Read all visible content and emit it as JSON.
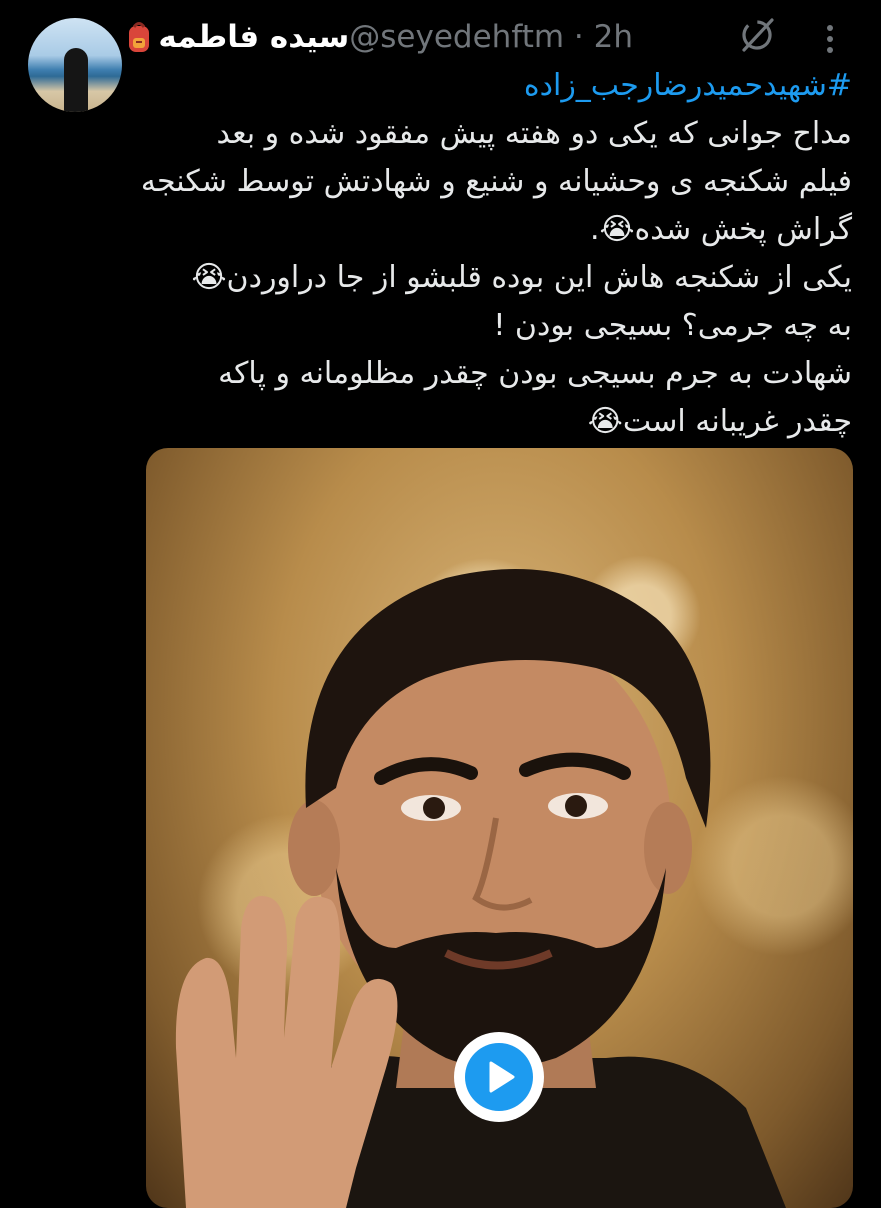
{
  "tweet": {
    "author": {
      "display_name": "سیده فاطمه",
      "name_emoji_icon": "backpack-icon",
      "handle": "@seyedehftm",
      "separator": "·",
      "time": "2h"
    },
    "actions": {
      "grok_icon": "grok-icon",
      "more_icon": "more-icon"
    },
    "hashtag": "#شهیدحمیدرضارجب_زاده",
    "lines": [
      "مداح جوانی که یکی دو هفته پیش مفقود شده و بعد",
      "فیلم شکنجه ی وحشیانه و شنیع و شهادتش توسط شکنجه",
      "گراش پخش شده😭.",
      "یکی از شکنجه هاش این بوده قلبشو از جا دراوردن😭",
      "به چه جرمی؟ بسیجی بودن !",
      "شهادت به جرم بسیجی بودن چقدر مظلومانه و پاکه",
      "چقدر غریبانه است😭"
    ],
    "media": {
      "type": "video",
      "play_icon": "play-icon"
    }
  },
  "colors": {
    "background": "#000000",
    "text": "#e7e9ea",
    "secondary": "#71767b",
    "accent": "#1d9bf0"
  }
}
